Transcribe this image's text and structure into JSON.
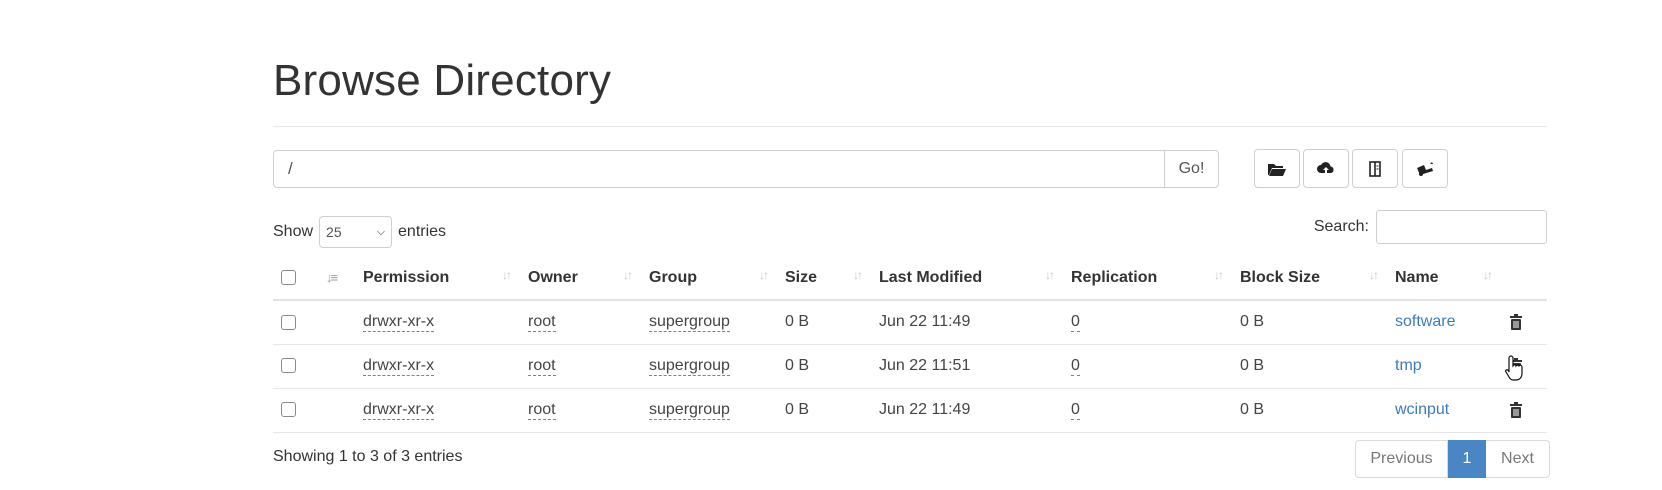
{
  "page": {
    "title": "Browse Directory"
  },
  "path_bar": {
    "value": "/",
    "go_label": "Go!"
  },
  "toolbar": {
    "buttons": [
      {
        "name": "create-directory-button",
        "icon": "folder-open-icon"
      },
      {
        "name": "upload-button",
        "icon": "cloud-upload-icon"
      },
      {
        "name": "cut-paste-button",
        "icon": "book-icon"
      },
      {
        "name": "truck-button",
        "icon": "truck-icon"
      }
    ]
  },
  "length": {
    "show_label": "Show",
    "value": "25",
    "entries_label": "entries"
  },
  "search": {
    "label": "Search:",
    "value": ""
  },
  "table": {
    "headers": [
      "Permission",
      "Owner",
      "Group",
      "Size",
      "Last Modified",
      "Replication",
      "Block Size",
      "Name"
    ],
    "rows": [
      {
        "permission": "drwxr-xr-x",
        "owner": "root",
        "group": "supergroup",
        "size": "0 B",
        "modified": "Jun 22 11:49",
        "replication": "0",
        "block_size": "0 B",
        "name": "software"
      },
      {
        "permission": "drwxr-xr-x",
        "owner": "root",
        "group": "supergroup",
        "size": "0 B",
        "modified": "Jun 22 11:51",
        "replication": "0",
        "block_size": "0 B",
        "name": "tmp"
      },
      {
        "permission": "drwxr-xr-x",
        "owner": "root",
        "group": "supergroup",
        "size": "0 B",
        "modified": "Jun 22 11:49",
        "replication": "0",
        "block_size": "0 B",
        "name": "wcinput"
      }
    ]
  },
  "footer": {
    "info": "Showing 1 to 3 of 3 entries",
    "prev_label": "Previous",
    "current_page": "1",
    "next_label": "Next"
  },
  "colors": {
    "link": "#3a7bbf",
    "active_page": "#4a86c5"
  }
}
